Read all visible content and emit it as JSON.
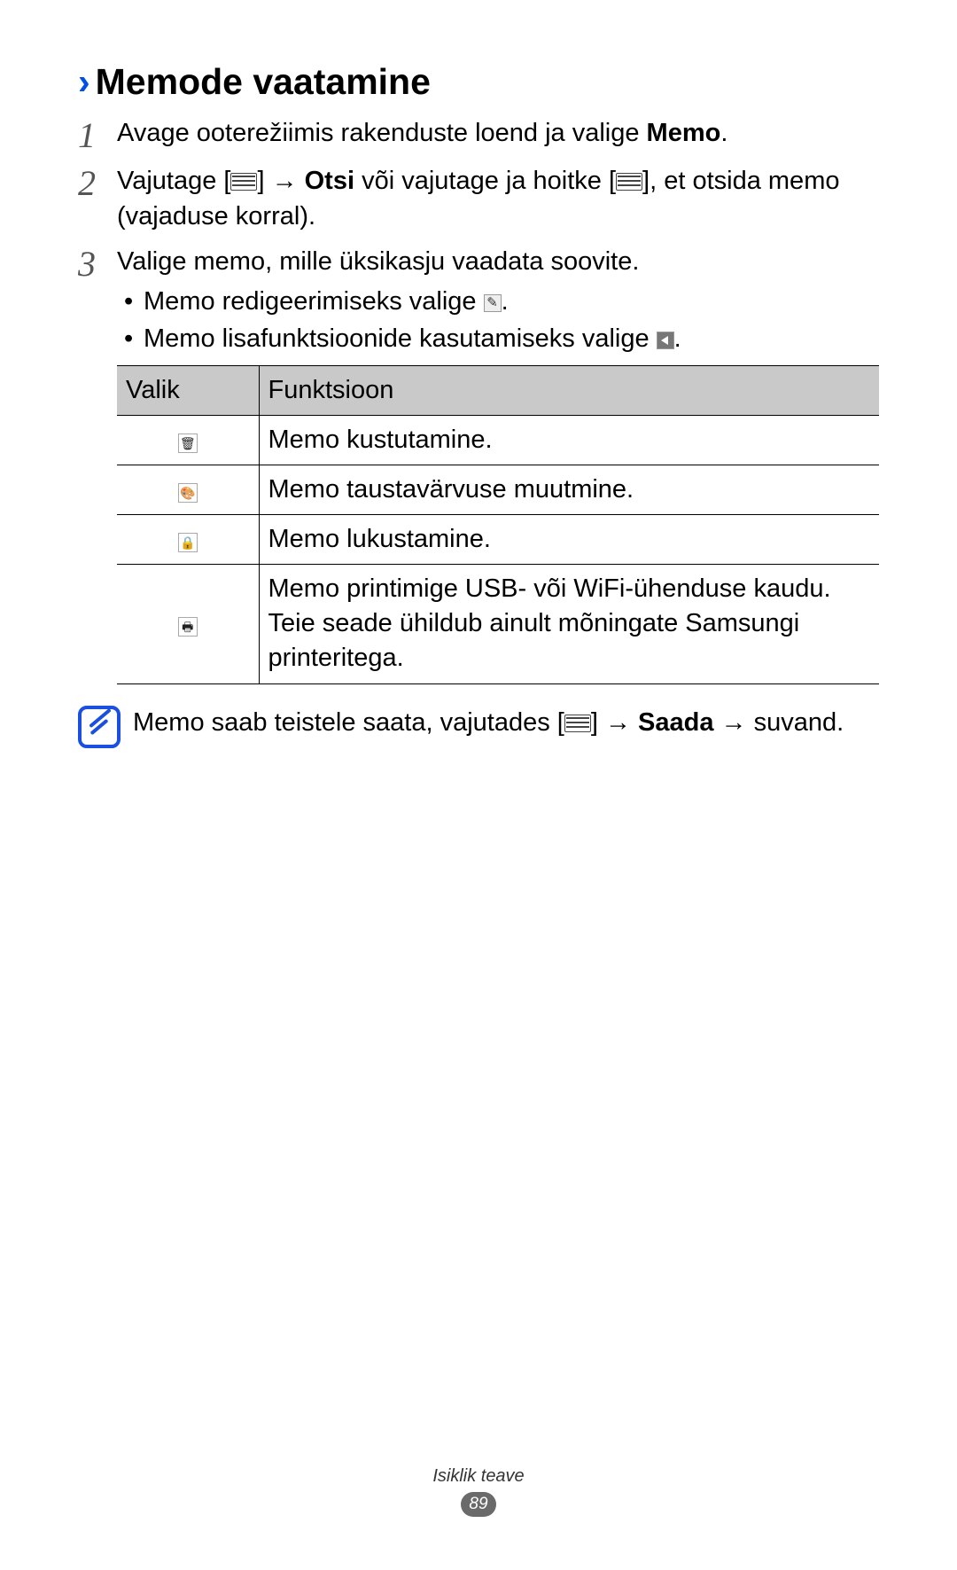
{
  "heading": "Memode vaatamine",
  "steps": {
    "s1": {
      "num": "1",
      "pre": "Avage ooterežiimis rakenduste loend ja valige ",
      "bold": "Memo",
      "post": "."
    },
    "s2": {
      "num": "2",
      "pre": "Vajutage [",
      "mid1": "] → ",
      "bold": "Otsi",
      "mid2": " või vajutage ja hoitke [",
      "post": "], et otsida memo (vajaduse korral)."
    },
    "s3": {
      "num": "3",
      "text": "Valige memo, mille üksikasju vaadata soovite.",
      "bul1_pre": "Memo redigeerimiseks valige ",
      "bul1_post": ".",
      "bul2_pre": "Memo lisafunktsioonide kasutamiseks valige ",
      "bul2_post": "."
    }
  },
  "table": {
    "head_option": "Valik",
    "head_function": "Funktsioon",
    "rows": [
      {
        "icon": "trash-icon",
        "glyph": "🗑",
        "fn": "Memo kustutamine."
      },
      {
        "icon": "palette-icon",
        "glyph": "🎨",
        "fn": "Memo taustavärvuse muutmine."
      },
      {
        "icon": "lock-icon",
        "glyph": "🔒",
        "fn": "Memo lukustamine."
      },
      {
        "icon": "printer-icon",
        "glyph": "🖶",
        "fn": "Memo printimige USB- või WiFi-ühenduse kaudu. Teie seade ühildub ainult mõningate Samsungi printeritega."
      }
    ]
  },
  "note": {
    "pre": "Memo saab teistele saata, vajutades [",
    "mid": "] → ",
    "bold": "Saada",
    "post": " → suvand."
  },
  "footer": {
    "section": "Isiklik teave",
    "page": "89"
  }
}
